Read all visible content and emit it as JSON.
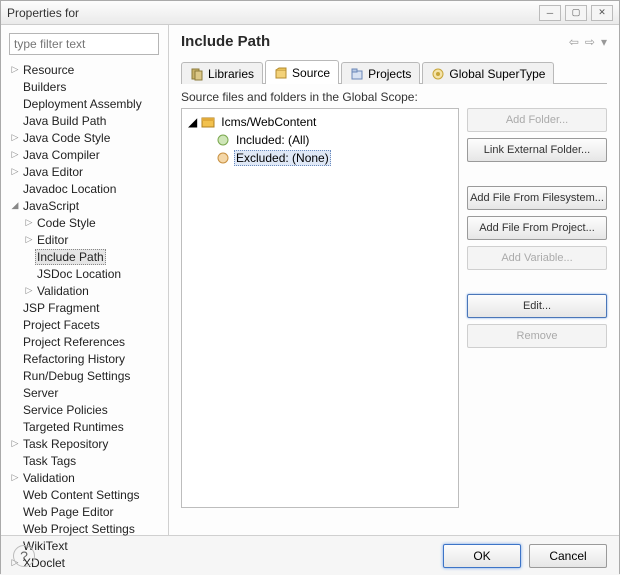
{
  "window": {
    "title": "Properties for"
  },
  "filter": {
    "placeholder": "type filter text"
  },
  "tree": [
    {
      "label": "Resource",
      "depth": 0,
      "expand": ">"
    },
    {
      "label": "Builders",
      "depth": 0,
      "expand": " "
    },
    {
      "label": "Deployment Assembly",
      "depth": 0,
      "expand": " "
    },
    {
      "label": "Java Build Path",
      "depth": 0,
      "expand": " "
    },
    {
      "label": "Java Code Style",
      "depth": 0,
      "expand": ">"
    },
    {
      "label": "Java Compiler",
      "depth": 0,
      "expand": ">"
    },
    {
      "label": "Java Editor",
      "depth": 0,
      "expand": ">"
    },
    {
      "label": "Javadoc Location",
      "depth": 0,
      "expand": " "
    },
    {
      "label": "JavaScript",
      "depth": 0,
      "expand": "v"
    },
    {
      "label": "Code Style",
      "depth": 1,
      "expand": ">"
    },
    {
      "label": "Editor",
      "depth": 1,
      "expand": ">"
    },
    {
      "label": "Include Path",
      "depth": 1,
      "expand": " ",
      "selected": true
    },
    {
      "label": "JSDoc Location",
      "depth": 1,
      "expand": " "
    },
    {
      "label": "Validation",
      "depth": 1,
      "expand": ">"
    },
    {
      "label": "JSP Fragment",
      "depth": 0,
      "expand": " "
    },
    {
      "label": "Project Facets",
      "depth": 0,
      "expand": " "
    },
    {
      "label": "Project References",
      "depth": 0,
      "expand": " "
    },
    {
      "label": "Refactoring History",
      "depth": 0,
      "expand": " "
    },
    {
      "label": "Run/Debug Settings",
      "depth": 0,
      "expand": " "
    },
    {
      "label": "Server",
      "depth": 0,
      "expand": " "
    },
    {
      "label": "Service Policies",
      "depth": 0,
      "expand": " "
    },
    {
      "label": "Targeted Runtimes",
      "depth": 0,
      "expand": " "
    },
    {
      "label": "Task Repository",
      "depth": 0,
      "expand": ">"
    },
    {
      "label": "Task Tags",
      "depth": 0,
      "expand": " "
    },
    {
      "label": "Validation",
      "depth": 0,
      "expand": ">"
    },
    {
      "label": "Web Content Settings",
      "depth": 0,
      "expand": " "
    },
    {
      "label": "Web Page Editor",
      "depth": 0,
      "expand": " "
    },
    {
      "label": "Web Project Settings",
      "depth": 0,
      "expand": " "
    },
    {
      "label": "WikiText",
      "depth": 0,
      "expand": " "
    },
    {
      "label": "XDoclet",
      "depth": 0,
      "expand": ">"
    }
  ],
  "right": {
    "heading": "Include Path",
    "tabs": [
      "Libraries",
      "Source",
      "Projects",
      "Global SuperType"
    ],
    "active_tab": 1,
    "subhead": "Source files and folders in the Global Scope:",
    "source_tree": {
      "root": "Icms/WebContent",
      "included": "Included: (All)",
      "excluded": "Excluded: (None)"
    },
    "buttons": {
      "add_folder": "Add Folder...",
      "link_ext": "Link External Folder...",
      "add_fs": "Add File From Filesystem...",
      "add_proj": "Add File From Project...",
      "add_var": "Add Variable...",
      "edit": "Edit...",
      "remove": "Remove"
    }
  },
  "footer": {
    "ok": "OK",
    "cancel": "Cancel"
  }
}
